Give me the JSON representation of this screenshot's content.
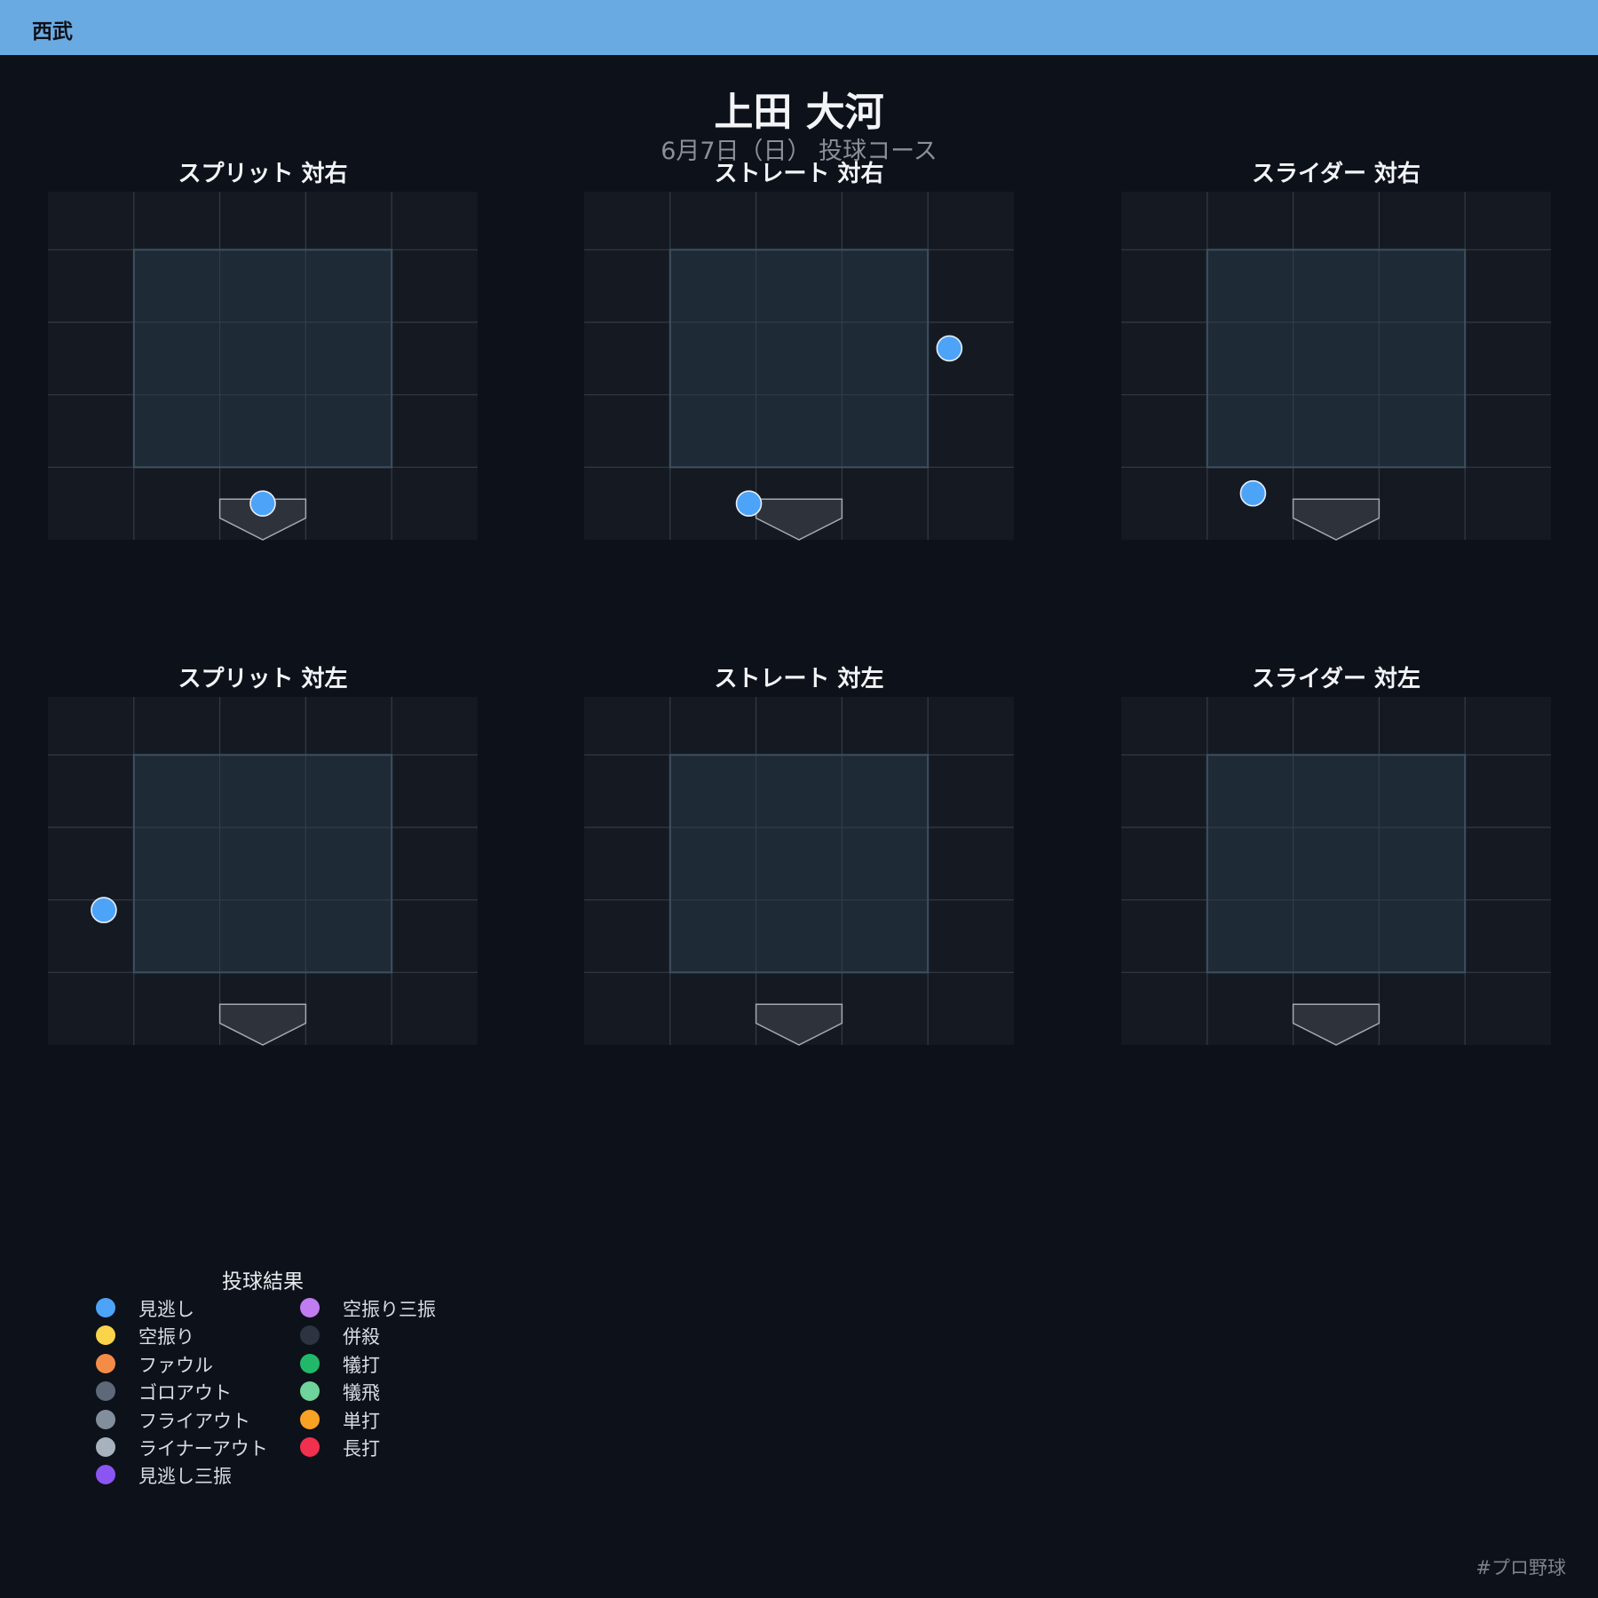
{
  "team": {
    "name": "西武",
    "color": "#6aaae3"
  },
  "header": {
    "player_name": "上田 大河",
    "subtitle": "6月7日（日） 投球コース"
  },
  "chart_data": [
    {
      "type": "scatter",
      "title": "スプリット 対右",
      "xlim": [
        -1.5,
        1.5
      ],
      "ylim": [
        -0.2,
        2.2
      ],
      "points": [
        {
          "x": 0.0,
          "y": 0.05,
          "result": "見逃し"
        }
      ]
    },
    {
      "type": "scatter",
      "title": "ストレート 対右",
      "xlim": [
        -1.5,
        1.5
      ],
      "ylim": [
        -0.2,
        2.2
      ],
      "points": [
        {
          "x": 1.05,
          "y": 1.12,
          "result": "見逃し"
        },
        {
          "x": -0.35,
          "y": 0.05,
          "result": "見逃し"
        }
      ]
    },
    {
      "type": "scatter",
      "title": "スライダー 対右",
      "xlim": [
        -1.5,
        1.5
      ],
      "ylim": [
        -0.2,
        2.2
      ],
      "points": [
        {
          "x": -0.58,
          "y": 0.12,
          "result": "見逃し"
        }
      ]
    },
    {
      "type": "scatter",
      "title": "スプリット 対左",
      "xlim": [
        -1.5,
        1.5
      ],
      "ylim": [
        -0.2,
        2.2
      ],
      "points": [
        {
          "x": -1.11,
          "y": 0.73,
          "result": "見逃し"
        }
      ]
    },
    {
      "type": "scatter",
      "title": "ストレート 対左",
      "xlim": [
        -1.5,
        1.5
      ],
      "ylim": [
        -0.2,
        2.2
      ],
      "points": []
    },
    {
      "type": "scatter",
      "title": "スライダー 対左",
      "xlim": [
        -1.5,
        1.5
      ],
      "ylim": [
        -0.2,
        2.2
      ],
      "points": []
    }
  ],
  "legend": {
    "title": "投球結果",
    "items": [
      {
        "label": "見逃し",
        "color": "#4da3f7"
      },
      {
        "label": "空振り",
        "color": "#f9d44a"
      },
      {
        "label": "ファウル",
        "color": "#f48c47"
      },
      {
        "label": "ゴロアウト",
        "color": "#5d6878"
      },
      {
        "label": "フライアウト",
        "color": "#838e9c"
      },
      {
        "label": "ライナーアウト",
        "color": "#a8b2be"
      },
      {
        "label": "見逃し三振",
        "color": "#8b55f3"
      },
      {
        "label": "空振り三振",
        "color": "#c17cf1"
      },
      {
        "label": "併殺",
        "color": "#2c3441"
      },
      {
        "label": "犠打",
        "color": "#22b86a"
      },
      {
        "label": "犠飛",
        "color": "#6fd39b"
      },
      {
        "label": "単打",
        "color": "#f9a125"
      },
      {
        "label": "長打",
        "color": "#f0304e"
      }
    ]
  },
  "footer": {
    "hashtag": "#プロ野球"
  }
}
